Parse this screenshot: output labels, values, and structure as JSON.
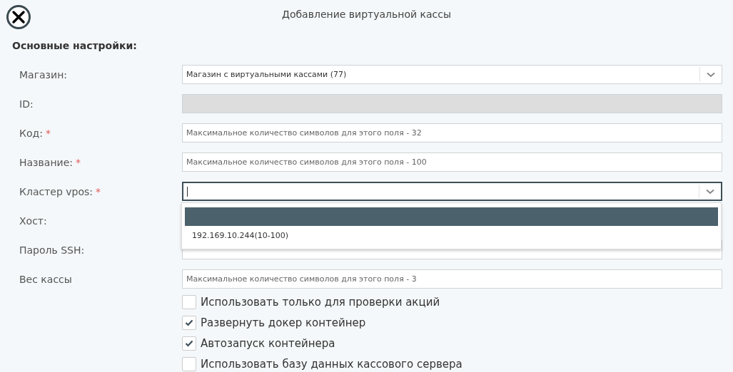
{
  "dialog": {
    "title": "Добавление виртуальной кассы"
  },
  "section": {
    "heading": "Основные настройки:"
  },
  "fields": [
    {
      "label": "Магазин:",
      "kind": "select",
      "value": "Магазин с виртуальными кассами (77)"
    },
    {
      "label": "ID:",
      "kind": "readonly"
    },
    {
      "label": "Код:",
      "required": "*",
      "kind": "text",
      "placeholder": "Максимальное количество символов для этого поля - 32"
    },
    {
      "label": "Название:",
      "required": "*",
      "kind": "text",
      "placeholder": "Максимальное количество символов для этого поля - 100"
    },
    {
      "label": "Кластер vpos:",
      "required": "*",
      "kind": "combo",
      "focused": true,
      "options": [
        {
          "selected": true
        },
        {
          "label": "192.169.10.244(10-100)",
          "selected": false
        }
      ]
    },
    {
      "label": "Хост:",
      "kind": "covered"
    },
    {
      "label": "Пароль SSH:",
      "kind": "text"
    },
    {
      "label": "Вес кассы",
      "kind": "text",
      "placeholder": "Максимальное количество символов для этого поля - 3"
    }
  ],
  "checkboxes": [
    {
      "label": "Использовать только для проверки акций",
      "checked": false
    },
    {
      "label": "Развернуть докер контейнер",
      "checked": true
    },
    {
      "label": "Автозапуск контейнера",
      "checked": true
    },
    {
      "label": "Использовать базу данных кассового сервера",
      "checked": false
    }
  ]
}
